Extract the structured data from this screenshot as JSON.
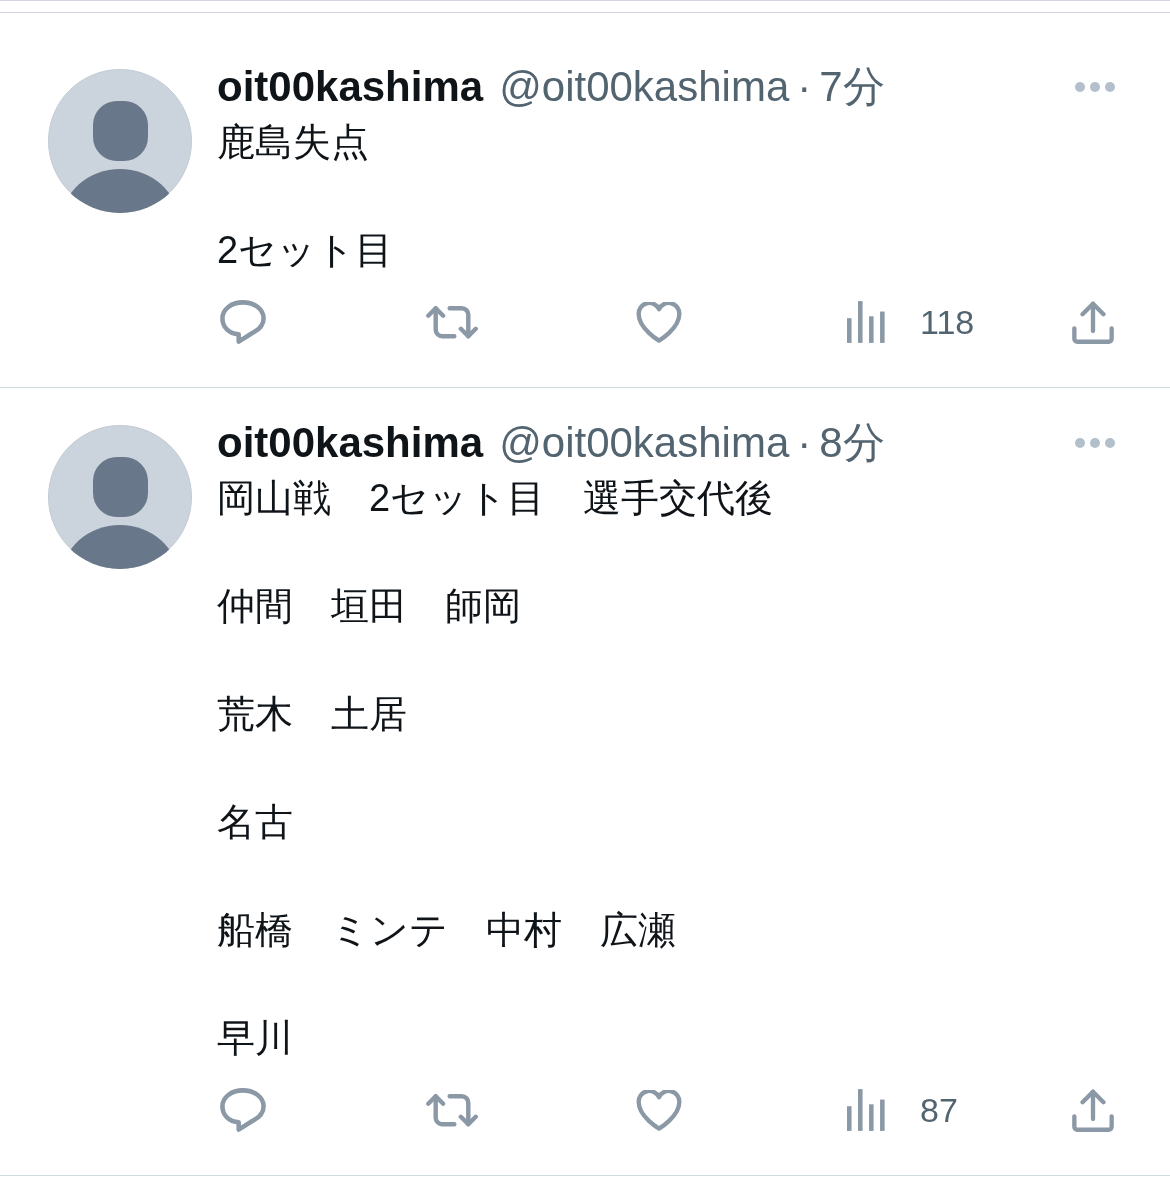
{
  "tweets": [
    {
      "display_name": "oit00kashima",
      "handle": "@oit00kashima",
      "separator": "·",
      "time": "7分",
      "paragraphs": [
        "鹿島失点",
        "2セット目"
      ],
      "views": "118"
    },
    {
      "display_name": "oit00kashima",
      "handle": "@oit00kashima",
      "separator": "·",
      "time": "8分",
      "paragraphs": [
        "岡山戦　2セット目　選手交代後",
        "仲間　垣田　師岡",
        "荒木　土居",
        "名古",
        "船橋　ミンテ　中村　広瀬",
        "早川"
      ],
      "views": "87"
    }
  ]
}
